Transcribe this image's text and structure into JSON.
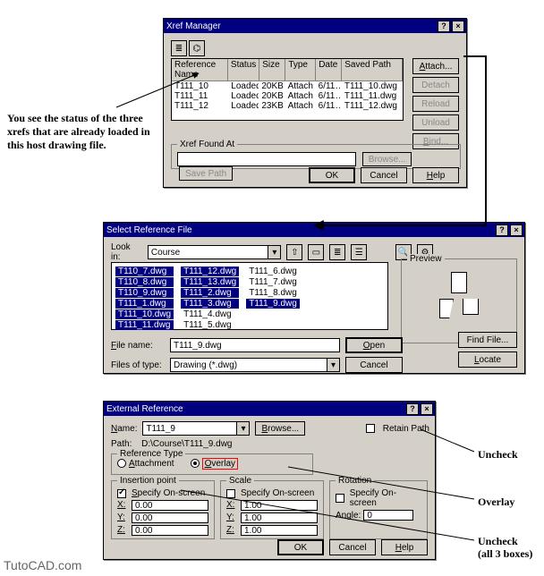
{
  "watermark": "TutoCAD.com",
  "side_note": "You see the status of the three xrefs that are already loaded in this host drawing file.",
  "annotations": {
    "uncheck": "Uncheck",
    "overlay": "Overlay",
    "uncheck3_line1": "Uncheck",
    "uncheck3_line2": "(all 3 boxes)"
  },
  "xref_mgr": {
    "title": "Xref Manager",
    "headers": [
      "Reference Name",
      "Status",
      "Size",
      "Type",
      "Date",
      "Saved Path"
    ],
    "rows": [
      {
        "name": "T111_10",
        "status": "Loaded",
        "size": "20KB",
        "type": "Attach",
        "date": "6/11…",
        "path": "T111_10.dwg"
      },
      {
        "name": "T111_11",
        "status": "Loaded",
        "size": "20KB",
        "type": "Attach",
        "date": "6/11…",
        "path": "T111_11.dwg"
      },
      {
        "name": "T111_12",
        "status": "Loaded",
        "size": "23KB",
        "type": "Attach",
        "date": "6/11…",
        "path": "T111_12.dwg"
      }
    ],
    "buttons": {
      "attach": "Attach...",
      "detach": "Detach",
      "reload": "Reload",
      "unload": "Unload",
      "bind": "Bind..."
    },
    "xref_found_legend": "Xref Found At",
    "browse": "Browse...",
    "save_path": "Save Path",
    "found_path": "",
    "ok": "OK",
    "cancel": "Cancel",
    "help": "Help"
  },
  "select_ref": {
    "title": "Select Reference File",
    "look_in": "Look in:",
    "look_in_val": "Course",
    "files_col1": [
      "T110_7.dwg",
      "T110_8.dwg",
      "T110_9.dwg",
      "T111_1.dwg",
      "T111_10.dwg",
      "T111_11.dwg"
    ],
    "files_col2": [
      "T111_12.dwg",
      "T111_13.dwg",
      "T111_2.dwg",
      "T111_3.dwg",
      "T111_4.dwg",
      "T111_5.dwg"
    ],
    "files_col3": [
      "T111_6.dwg",
      "T111_7.dwg",
      "T111_8.dwg",
      "T111_9.dwg"
    ],
    "selected": "T111_9.dwg",
    "file_name": "File name:",
    "file_name_val": "T111_9.dwg",
    "files_of_type": "Files of type:",
    "files_of_type_val": "Drawing (*.dwg)",
    "open": "Open",
    "cancel": "Cancel",
    "find_file": "Find File...",
    "locate": "Locate",
    "preview": "Preview"
  },
  "ext_ref": {
    "title": "External Reference",
    "name_label": "Name:",
    "name_val": "T111_9",
    "browse": "Browse...",
    "retain_path": "Retain Path",
    "path_label": "Path:",
    "path_val": "D:\\Course\\T111_9.dwg",
    "ref_type_legend": "Reference Type",
    "attachment": "Attachment",
    "overlay": "Overlay",
    "ins_legend": "Insertion point",
    "scale_legend": "Scale",
    "rot_legend": "Rotation",
    "spec_screen": "Specify On-screen",
    "x_label": "X:",
    "y_label": "Y:",
    "z_label": "Z:",
    "angle_label": "Angle:",
    "ins_x": "0.00",
    "ins_y": "0.00",
    "ins_z": "0.00",
    "scl_x": "1.00",
    "scl_y": "1.00",
    "scl_z": "1.00",
    "angle": "0",
    "ok": "OK",
    "cancel": "Cancel",
    "help": "Help"
  }
}
